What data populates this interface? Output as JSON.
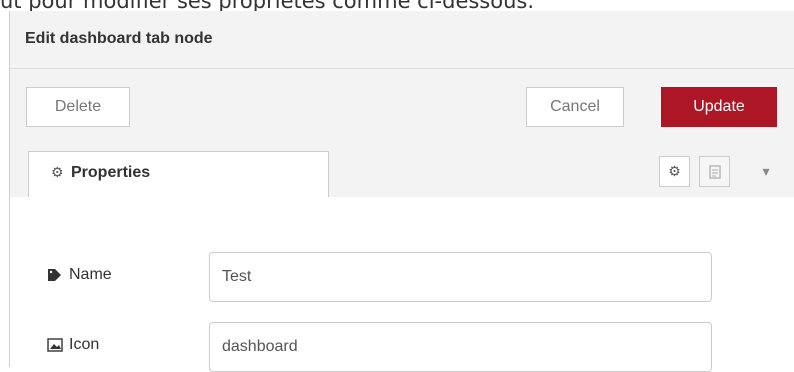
{
  "caption": {
    "text": "ut pour modifier ses propriétés comme ci-dessous."
  },
  "tray": {
    "title": "Edit dashboard tab node",
    "delete_label": "Delete",
    "cancel_label": "Cancel",
    "update_label": "Update",
    "update_color": "#ad1625"
  },
  "tabs": {
    "properties_label": "Properties",
    "properties_icon": "gear-icon",
    "toolbar_icons": [
      "gear-icon",
      "document-icon",
      "caret-down-icon"
    ]
  },
  "form": {
    "name_label": "Name",
    "name_icon": "tag-icon",
    "name_value": "Test",
    "icon_label": "Icon",
    "icon_icon": "image-icon",
    "icon_value": "dashboard"
  }
}
